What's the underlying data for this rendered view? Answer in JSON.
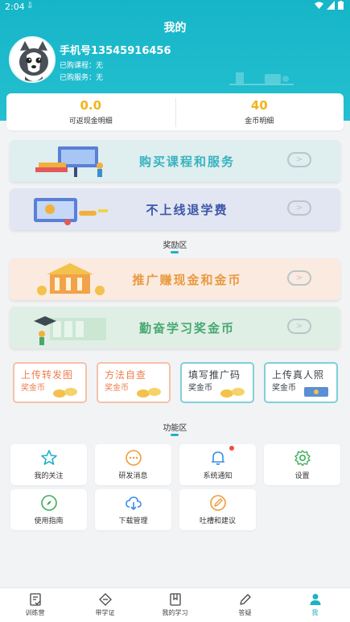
{
  "status_bar": {
    "time": "2:04",
    "download_icon": "download-arrow-icon"
  },
  "header": {
    "title": "我的",
    "phone_label": "手机号13545916456",
    "purchased_courses": "已购课程：无",
    "purchased_services": "已购服务：无"
  },
  "stats": [
    {
      "value": "0.0",
      "label": "可返现金明细"
    },
    {
      "value": "40",
      "label": "金币明细"
    }
  ],
  "banners": [
    {
      "label": "购买课程和服务"
    },
    {
      "label": "不上线退学费"
    }
  ],
  "reward_section": {
    "title": "奖励区",
    "banners": [
      {
        "label": "推广赚现金和金币"
      },
      {
        "label": "勤奋学习奖金币"
      }
    ],
    "cards": [
      {
        "title": "上传转发图",
        "subtitle": "奖金币"
      },
      {
        "title": "方法自查",
        "subtitle": "奖金币"
      },
      {
        "title": "填写推广码",
        "subtitle": "奖金币"
      },
      {
        "title": "上传真人照",
        "subtitle": "奖金币"
      }
    ]
  },
  "function_section": {
    "title": "功能区",
    "items": [
      {
        "label": "我的关注",
        "icon": "star-icon"
      },
      {
        "label": "研发消息",
        "icon": "message-icon"
      },
      {
        "label": "系统通知",
        "icon": "bell-icon",
        "has_badge": true
      },
      {
        "label": "设置",
        "icon": "gear-icon"
      },
      {
        "label": "使用指南",
        "icon": "compass-icon"
      },
      {
        "label": "下载管理",
        "icon": "cloud-download-icon"
      },
      {
        "label": "吐槽和建议",
        "icon": "edit-icon"
      }
    ]
  },
  "tab_bar": {
    "active": "我",
    "tabs": [
      {
        "label": "训练营",
        "icon": "document-check-icon"
      },
      {
        "label": "带学证",
        "icon": "ticket-icon"
      },
      {
        "label": "我的学习",
        "icon": "book-icon"
      },
      {
        "label": "答疑",
        "icon": "pencil-icon"
      },
      {
        "label": "我",
        "icon": "person-icon"
      }
    ]
  },
  "colors": {
    "header": "#1db3c6",
    "accent": "#1db3c6",
    "gold": "#f1b51a",
    "orange": "#ee7d4c"
  }
}
